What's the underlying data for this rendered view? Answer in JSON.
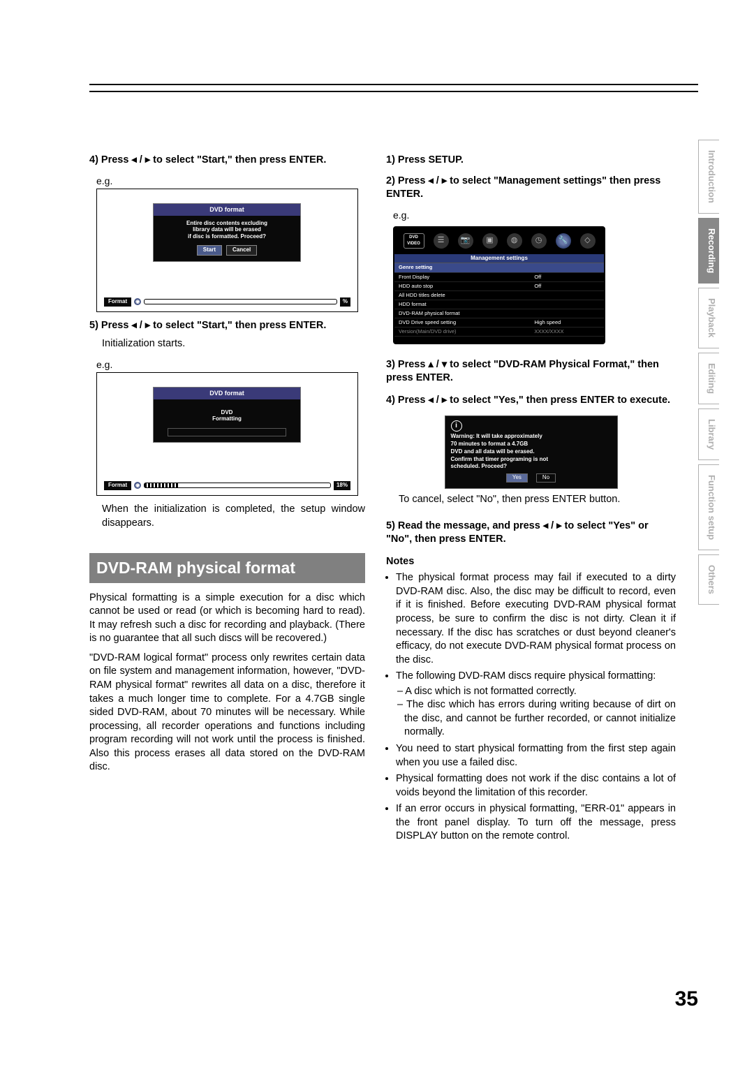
{
  "page_number": "35",
  "side_tabs": {
    "t0": "Introduction",
    "t1": "Recording",
    "t2": "Playback",
    "t3": "Editing",
    "t4": "Library",
    "t5": "Function setup",
    "t6": "Others"
  },
  "left": {
    "step4": "4) Press ◂ / ▸ to select \"Start,\" then press ENTER.",
    "eg": "e.g.",
    "diag1": {
      "title": "DVD format",
      "msg_l1": "Entire disc contents excluding",
      "msg_l2": "library data will be erased",
      "msg_l3": "if disc is formatted. Proceed?",
      "btn_start": "Start",
      "btn_cancel": "Cancel",
      "bottom_label": "Format",
      "bottom_end": "%"
    },
    "step5": "5) Press ◂ / ▸ to select \"Start,\" then press ENTER.",
    "step5_sub": "Initialization starts.",
    "diag2": {
      "title": "DVD format",
      "msg_l1": "DVD",
      "msg_l2": "Formatting",
      "bottom_label": "Format",
      "bottom_end": "18%"
    },
    "after": "When the initialization is completed, the setup window disappears.",
    "section_header": "DVD-RAM physical format",
    "para1": "Physical formatting is a simple execution for a disc which cannot be used or read (or which is becoming hard to read). It may refresh such a disc for recording and playback. (There is no guarantee that all such discs will be recovered.)",
    "para2": "\"DVD-RAM logical format\" process only rewrites certain data on file system and management information, however, \"DVD-RAM physical format\" rewrites all data on a disc, therefore it takes a much longer time to complete. For a 4.7GB single sided DVD-RAM, about 70 minutes will be necessary. While processing, all recorder operations and functions including program recording will not work until the process is finished. Also this process erases all data stored on the DVD-RAM disc."
  },
  "right": {
    "step1": "1) Press SETUP.",
    "step2": "2) Press ◂ / ▸ to select \"Management settings\" then press ENTER.",
    "eg": "e.g.",
    "mgmt": {
      "icon_dvd_top": "DVD",
      "icon_dvd_bot": "VIDEO",
      "title": "Management settings",
      "rows": [
        {
          "k": "Genre setting",
          "v": ""
        },
        {
          "k": "Front Display",
          "v": "Off"
        },
        {
          "k": "HDD auto stop",
          "v": "Off"
        },
        {
          "k": "All HDD titles delete",
          "v": ""
        },
        {
          "k": "HDD format",
          "v": ""
        },
        {
          "k": "DVD-RAM physical format",
          "v": ""
        },
        {
          "k": "DVD Drive speed setting",
          "v": "High speed"
        },
        {
          "k": "Version(Main/DVD drive)",
          "v": "XXXX/XXXX"
        }
      ]
    },
    "step3": "3) Press ▴ / ▾ to select \"DVD-RAM Physical Format,\" then press ENTER.",
    "step4": "4) Press ◂ / ▸ to select \"Yes,\" then press ENTER to execute.",
    "warn": {
      "l1": "Warning: It will take approximately",
      "l2": "70 minutes to format a 4.7GB",
      "l3": "DVD and all data will be erased.",
      "l4": "Confirm that timer programing is not",
      "l5": "scheduled. Proceed?",
      "yes": "Yes",
      "no": "No"
    },
    "cancel_line": "To cancel, select \"No\", then press ENTER button.",
    "step5": "5) Read the message, and press ◂ / ▸ to select \"Yes\" or \"No\", then press ENTER.",
    "notes_header": "Notes",
    "note1": "The physical format process may fail if executed to a dirty DVD-RAM disc. Also, the disc may be difficult to record, even if it is finished. Before executing DVD-RAM physical format process, be sure to confirm the disc is not dirty. Clean it if necessary. If the disc has scratches or dust beyond cleaner's efficacy, do not execute DVD-RAM physical format process on the disc.",
    "note2": "The following DVD-RAM discs require physical formatting:",
    "note2a": "A disc which is not formatted correctly.",
    "note2b": "The disc which has errors during writing because of dirt on the disc, and cannot be further recorded, or cannot initialize normally.",
    "note3": "You need to start physical formatting from the first step again when you use a failed disc.",
    "note4": "Physical formatting does not work if the disc contains a lot of voids beyond the limitation of this recorder.",
    "note5": "If an error occurs in physical formatting, \"ERR-01\" appears in the front panel display. To turn off the message, press DISPLAY button on the remote control."
  }
}
